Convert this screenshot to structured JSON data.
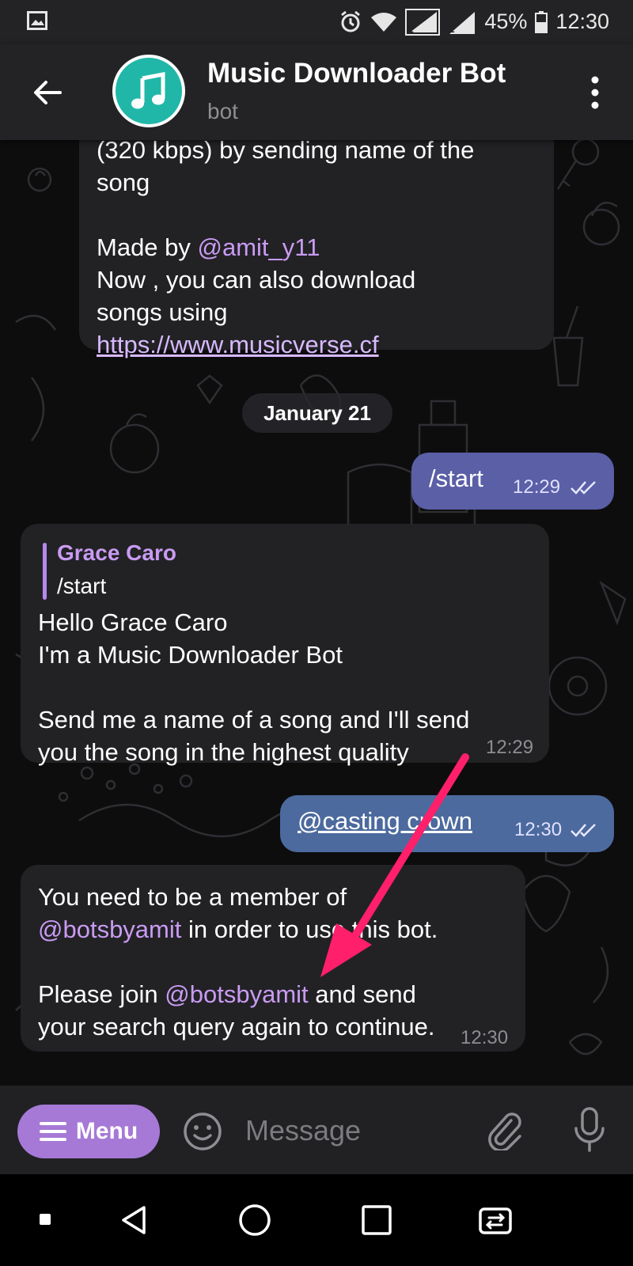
{
  "status_bar": {
    "battery": "45%",
    "time": "12:30",
    "icons": [
      "image-icon",
      "alarm-icon",
      "wifi-icon",
      "sim1-signal-icon",
      "sim2-signal-icon",
      "battery-icon"
    ]
  },
  "header": {
    "title": "Music Downloader Bot",
    "subtitle": "bot",
    "avatar_icon": "music-note-icon",
    "avatar_color": "#20b7a8"
  },
  "messages": {
    "intro": {
      "line1": "(320 kbps) by sending name of the",
      "line2": "song",
      "made_by_prefix": "Made by ",
      "made_by_link": "@amit_y11",
      "line4": "Now , you can also download",
      "line5": "songs using",
      "url": "https://www.musicverse.cf"
    },
    "date_separator": "January 21",
    "start_out": {
      "text": "/start",
      "time": "12:29"
    },
    "greeting": {
      "reply_name": "Grace Caro",
      "reply_text": "/start",
      "line1": "Hello Grace Caro",
      "line2": "I'm a Music Downloader Bot",
      "line3": "Send me a name of a song and I'll send",
      "line4": "you the song in the highest quality",
      "time": "12:29"
    },
    "casting_out": {
      "text": "@casting crown",
      "time": "12:30"
    },
    "membership": {
      "line1": "You need to be a member of",
      "line2_link": "@botsbyamit",
      "line2_rest": " in order to use this bot.",
      "line3_prefix": "Please join ",
      "line3_link": "@botsbyamit",
      "line3_rest": " and send",
      "line4": "your search query again to continue.",
      "time": "12:30"
    }
  },
  "input_bar": {
    "menu_label": "Menu",
    "placeholder": "Message"
  },
  "colors": {
    "accent": "#a679d6",
    "outgoing_bubble": "#5a5fa6",
    "incoming_bubble": "#222225",
    "link": "#c99bf2",
    "annotation_arrow": "#ff1f6a"
  }
}
